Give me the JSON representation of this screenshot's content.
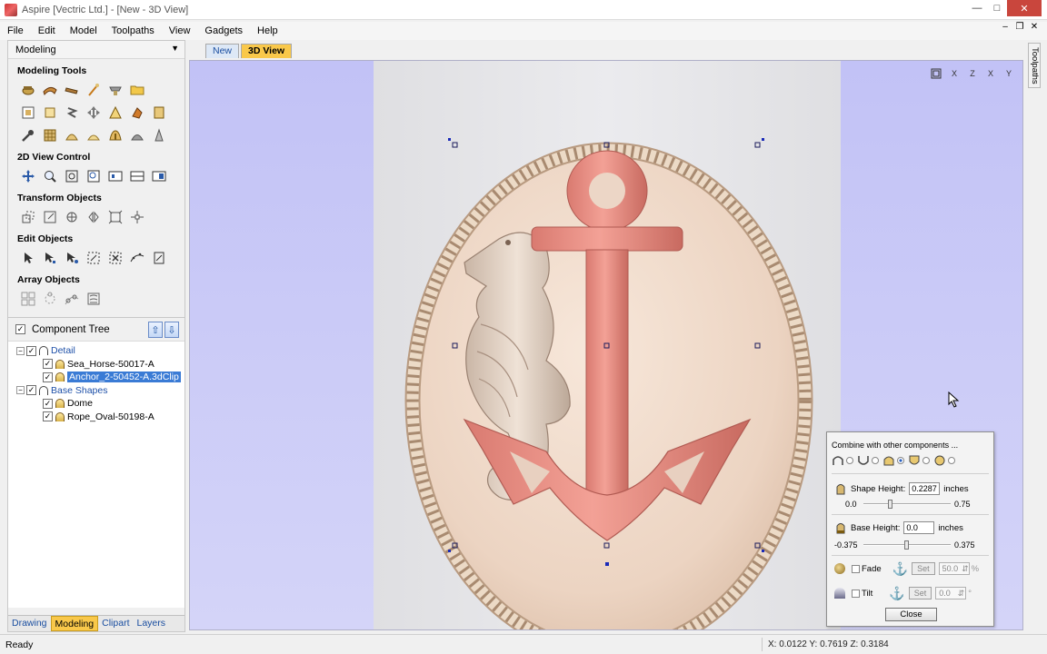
{
  "window": {
    "title": "Aspire [Vectric Ltd.] - [New - 3D View]"
  },
  "menu": {
    "items": [
      "File",
      "Edit",
      "Model",
      "Toolpaths",
      "View",
      "Gadgets",
      "Help"
    ]
  },
  "left_panel": {
    "header": "Modeling",
    "sections": {
      "modeling_tools": "Modeling Tools",
      "view_control": "2D View Control",
      "transform": "Transform Objects",
      "edit": "Edit Objects",
      "array": "Array Objects"
    },
    "component_tree": {
      "title": "Component Tree",
      "groups": [
        {
          "label": "Detail",
          "children": [
            "Sea_Horse-50017-A",
            "Anchor_2-50452-A.3dClip"
          ]
        },
        {
          "label": "Base Shapes",
          "children": [
            "Dome",
            "Rope_Oval-50198-A"
          ]
        }
      ]
    },
    "bottom_tabs": [
      "Drawing",
      "Modeling",
      "Clipart",
      "Layers"
    ],
    "active_bottom_tab": "Modeling"
  },
  "doc_tabs": [
    "New",
    "3D View"
  ],
  "active_doc_tab": "3D View",
  "right_tab": "Toolpaths",
  "view_toolbar": {
    "labels": [
      "X",
      "Z",
      "X",
      "Y"
    ]
  },
  "combine_dialog": {
    "title": "Combine with other components ...",
    "shape_height_label": "Shape Height:",
    "shape_height_value": "0.2287",
    "shape_height_unit": "inches",
    "shape_min": "0.0",
    "shape_max": "0.75",
    "base_height_label": "Base Height:",
    "base_height_value": "0.0",
    "base_height_unit": "inches",
    "base_min": "-0.375",
    "base_max": "0.375",
    "fade_label": "Fade",
    "fade_set": "Set",
    "fade_value": "50.0",
    "fade_unit": "%",
    "tilt_label": "Tilt",
    "tilt_set": "Set",
    "tilt_value": "0.0",
    "tilt_unit": "°",
    "close_label": "Close"
  },
  "status": {
    "text": "Ready",
    "coords": "X: 0.0122 Y: 0.7619 Z: 0.3184"
  },
  "colors": {
    "active_tab": "#f9c84a",
    "view_bg": "#c8c8f6",
    "anchor": "#e98a80",
    "rope": "#e6d2b8",
    "plaque": "#f0dccc"
  }
}
